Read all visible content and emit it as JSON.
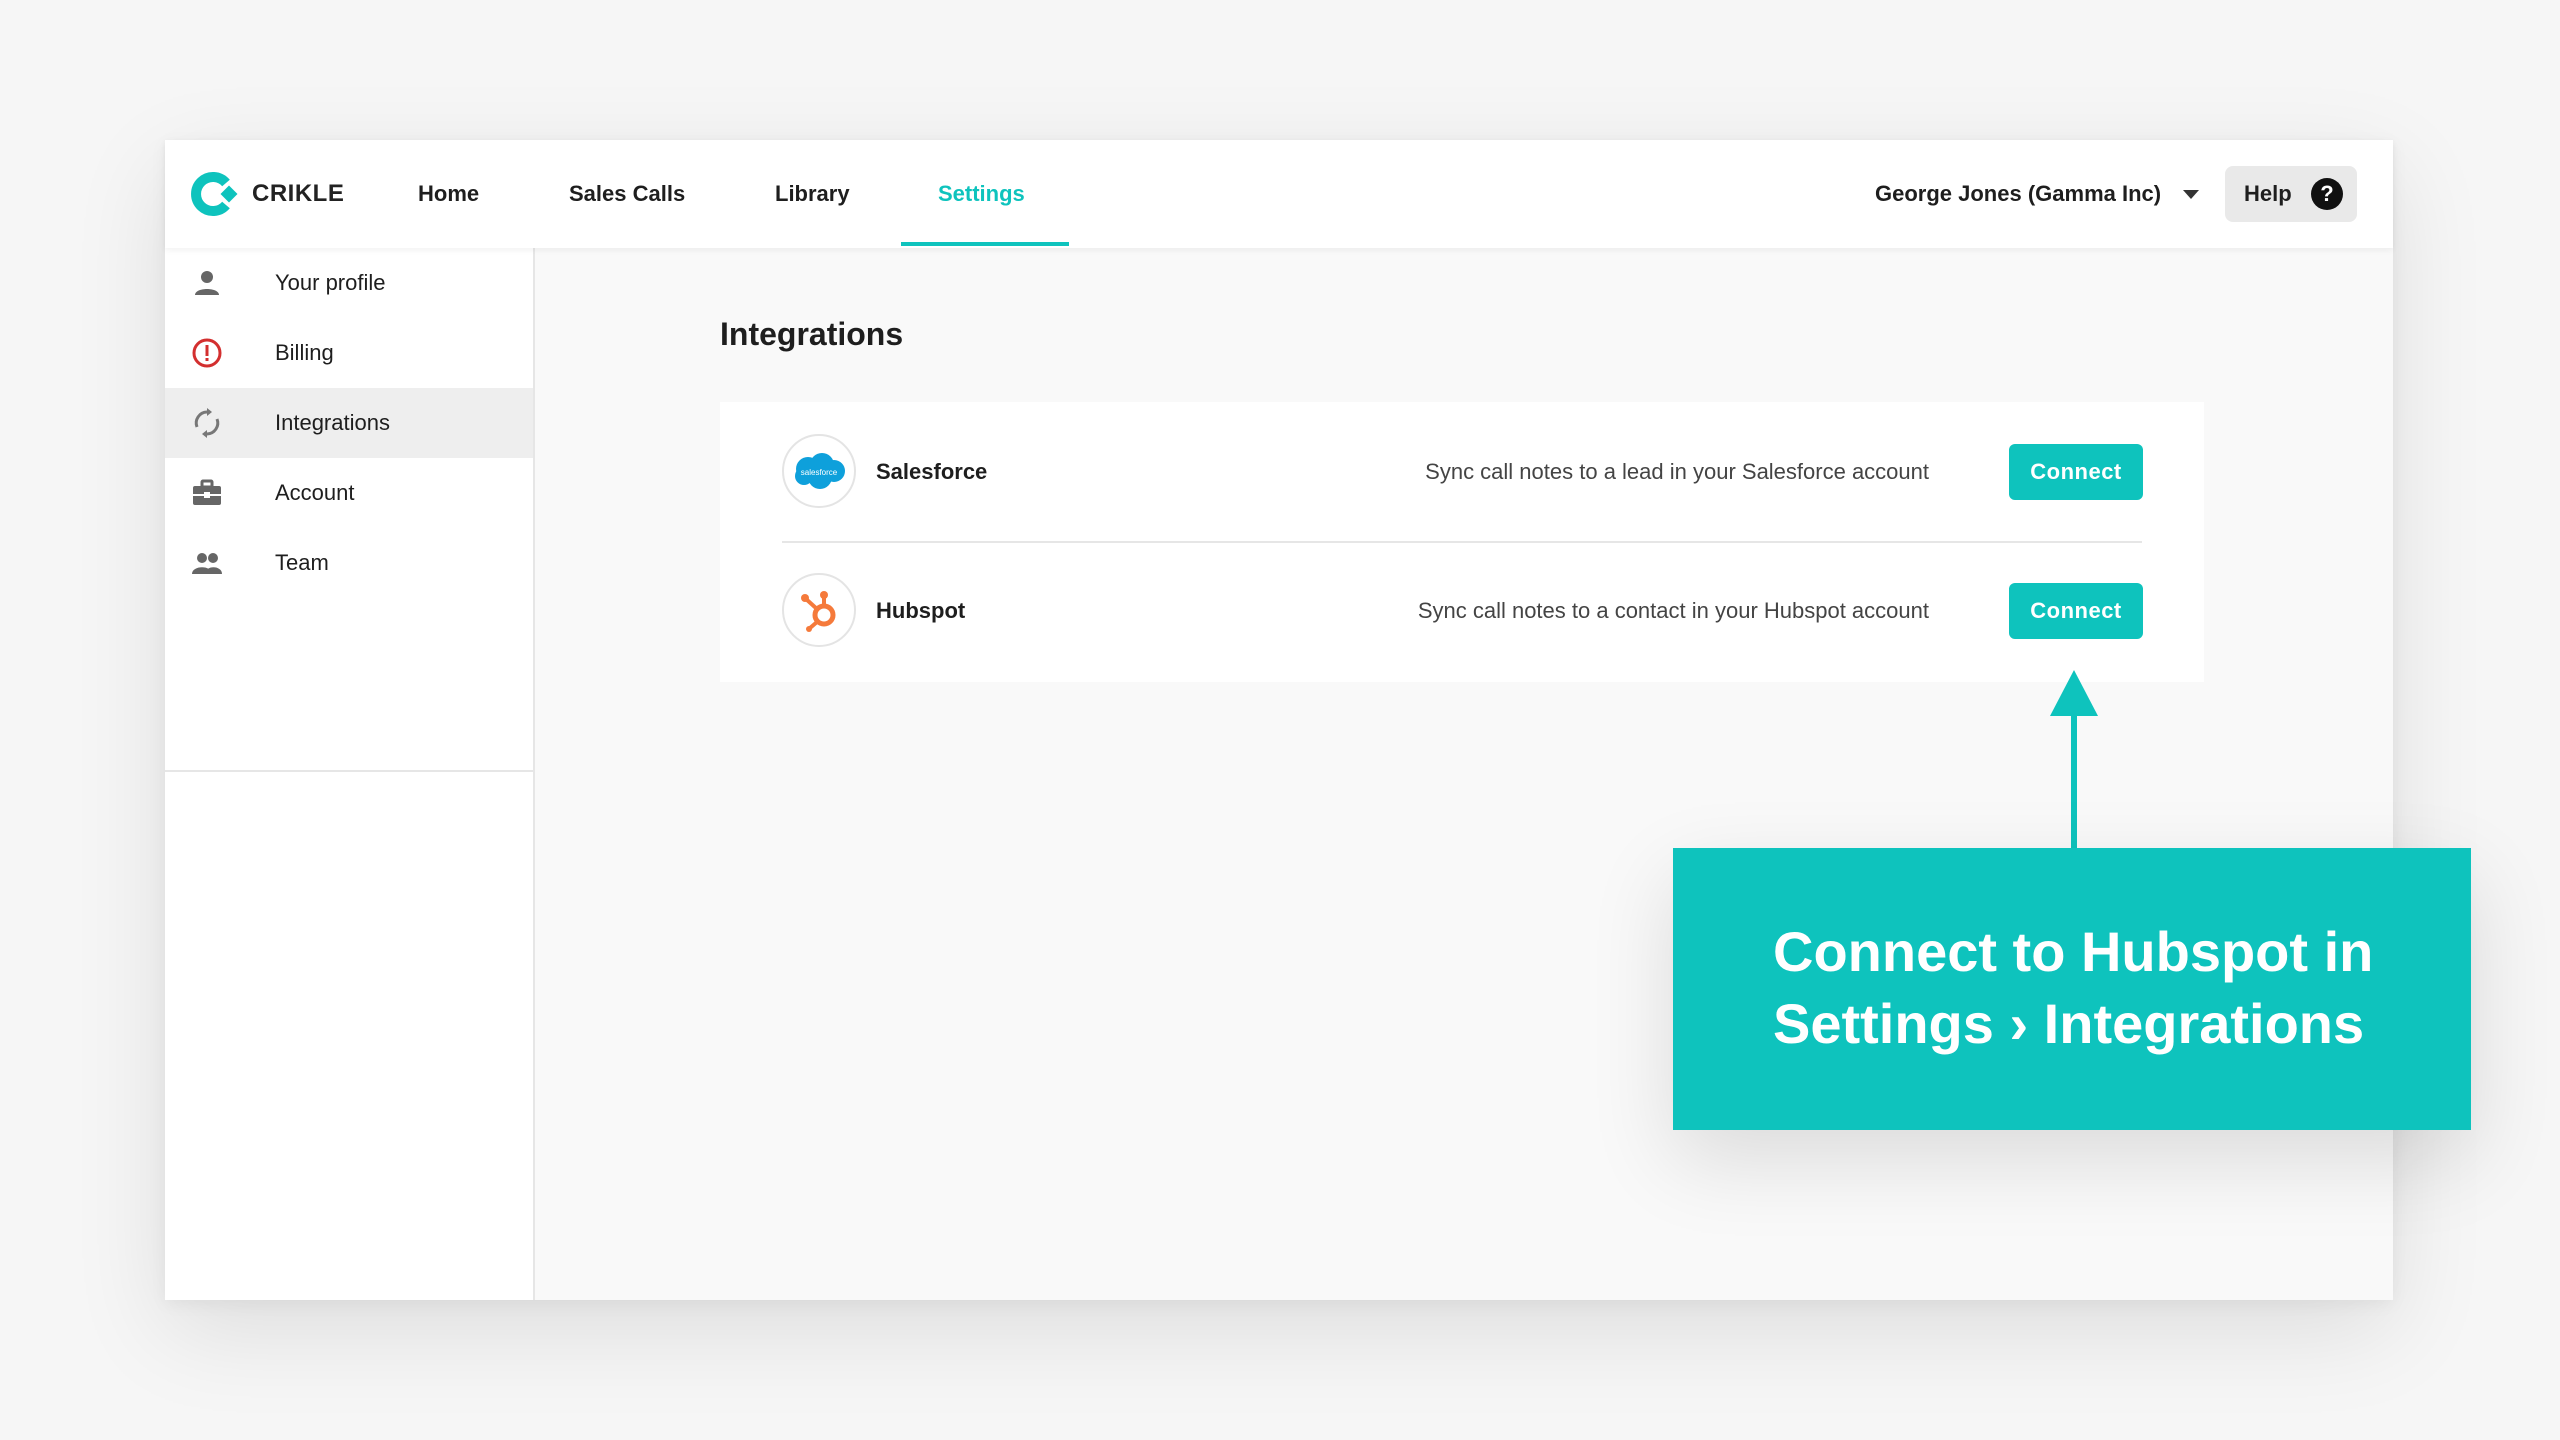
{
  "app": {
    "brand": "CRIKLE",
    "accent_color": "#0ec3bd"
  },
  "nav": {
    "items": [
      {
        "label": "Home"
      },
      {
        "label": "Sales Calls"
      },
      {
        "label": "Library"
      },
      {
        "label": "Settings",
        "active": true
      }
    ],
    "user_label": "George Jones (Gamma Inc)",
    "help_label": "Help",
    "help_icon": "?"
  },
  "sidebar": {
    "items": [
      {
        "label": "Your profile",
        "icon": "person-icon"
      },
      {
        "label": "Billing",
        "icon": "alert-circle-icon"
      },
      {
        "label": "Integrations",
        "icon": "sync-icon",
        "active": true
      },
      {
        "label": "Account",
        "icon": "briefcase-icon"
      },
      {
        "label": "Team",
        "icon": "group-icon"
      }
    ]
  },
  "main": {
    "title": "Integrations",
    "integrations": [
      {
        "name": "Salesforce",
        "logo_text": "salesforce",
        "description": "Sync call notes to a lead in your Salesforce account",
        "button_label": "Connect"
      },
      {
        "name": "Hubspot",
        "description": "Sync call notes to a contact in your Hubspot account",
        "button_label": "Connect"
      }
    ]
  },
  "callout": {
    "line1": "Connect to Hubspot in",
    "line2": "Settings › Integrations"
  }
}
